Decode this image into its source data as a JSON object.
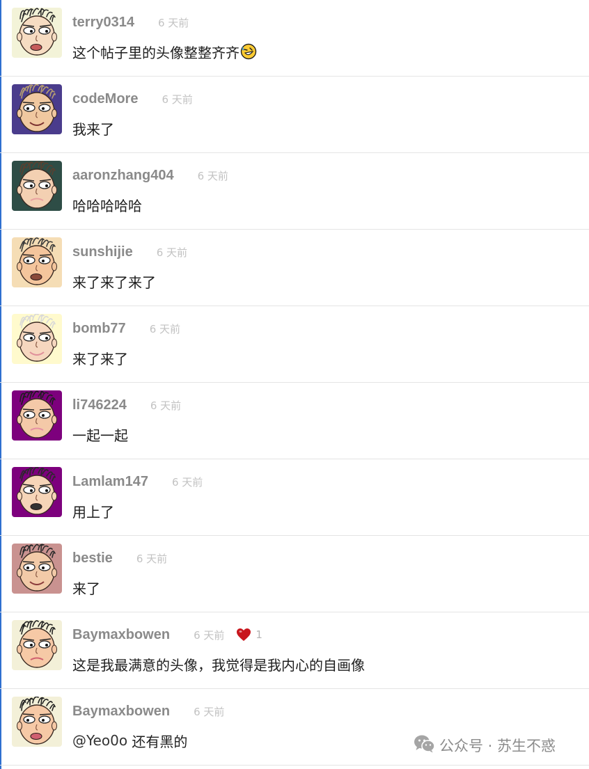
{
  "comments": [
    {
      "username": "terry0314",
      "time": "6 天前",
      "text": "这个帖子里的头像整整齐齐",
      "emoji": "rofl-emoji",
      "avatar_bg": "#f3f3d8",
      "face": "#f6dcc2",
      "hair": "#2a2a2a",
      "mouth": "#c65b5b"
    },
    {
      "username": "codeMore",
      "time": "6 天前",
      "text": "我来了",
      "avatar_bg": "#4a3c8c",
      "face": "#f0c8a0",
      "hair": "#b8a070",
      "mouth": "#7a3030"
    },
    {
      "username": "aaronzhang404",
      "time": "6 天前",
      "text": "哈哈哈哈哈",
      "avatar_bg": "#2e4d46",
      "face": "#f3d0b2",
      "hair": "#5a4030",
      "mouth": "#e9a1a1"
    },
    {
      "username": "sunshijie",
      "time": "6 天前",
      "text": "来了来了来了",
      "avatar_bg": "#f5ddb5",
      "face": "#f4c59c",
      "hair": "#3a3a3a",
      "mouth": "#8a4a3a"
    },
    {
      "username": "bomb77",
      "time": "6 天前",
      "text": "来了来了",
      "avatar_bg": "#fffacd",
      "face": "#f6d7bf",
      "hair": "#d8d8d8",
      "mouth": "#e08f9a"
    },
    {
      "username": "li746224",
      "time": "6 天前",
      "text": "一起一起",
      "avatar_bg": "#7d007d",
      "face": "#f4c9a8",
      "hair": "#1e1e1e",
      "mouth": "#e590a5"
    },
    {
      "username": "Lamlam147",
      "time": "6 天前",
      "text": "用上了",
      "avatar_bg": "#7d007d",
      "face": "#f6d5b8",
      "hair": "#2a2a2a",
      "mouth": "#333333"
    },
    {
      "username": "bestie",
      "time": "6 天前",
      "text": "来了",
      "avatar_bg": "#c99290",
      "face": "#f2caa8",
      "hair": "#2a2a2a",
      "mouth": "#8a3a3a"
    },
    {
      "username": "Baymaxbowen",
      "time": "6 天前",
      "text": "这是我最满意的头像，我觉得是我内心的自画像",
      "likes": "1",
      "avatar_bg": "#f3f0d8",
      "face": "#f6c9a6",
      "hair": "#222222",
      "mouth": "#d06070"
    },
    {
      "username": "Baymaxbowen",
      "time": "6 天前",
      "mention": "@Yeo0o",
      "text": " 还有黑的",
      "avatar_bg": "#f3f0d8",
      "face": "#f6c9a6",
      "hair": "#222222",
      "mouth": "#d06070"
    }
  ],
  "colors": {
    "username": "#8a8a8a",
    "time": "#c2c2c2",
    "text": "#1e1e1e",
    "heart": "#c8161d",
    "left_edge": "#2f6fcf"
  },
  "watermark": {
    "icon": "wechat-icon",
    "text": "公众号 · 苏生不惑"
  }
}
